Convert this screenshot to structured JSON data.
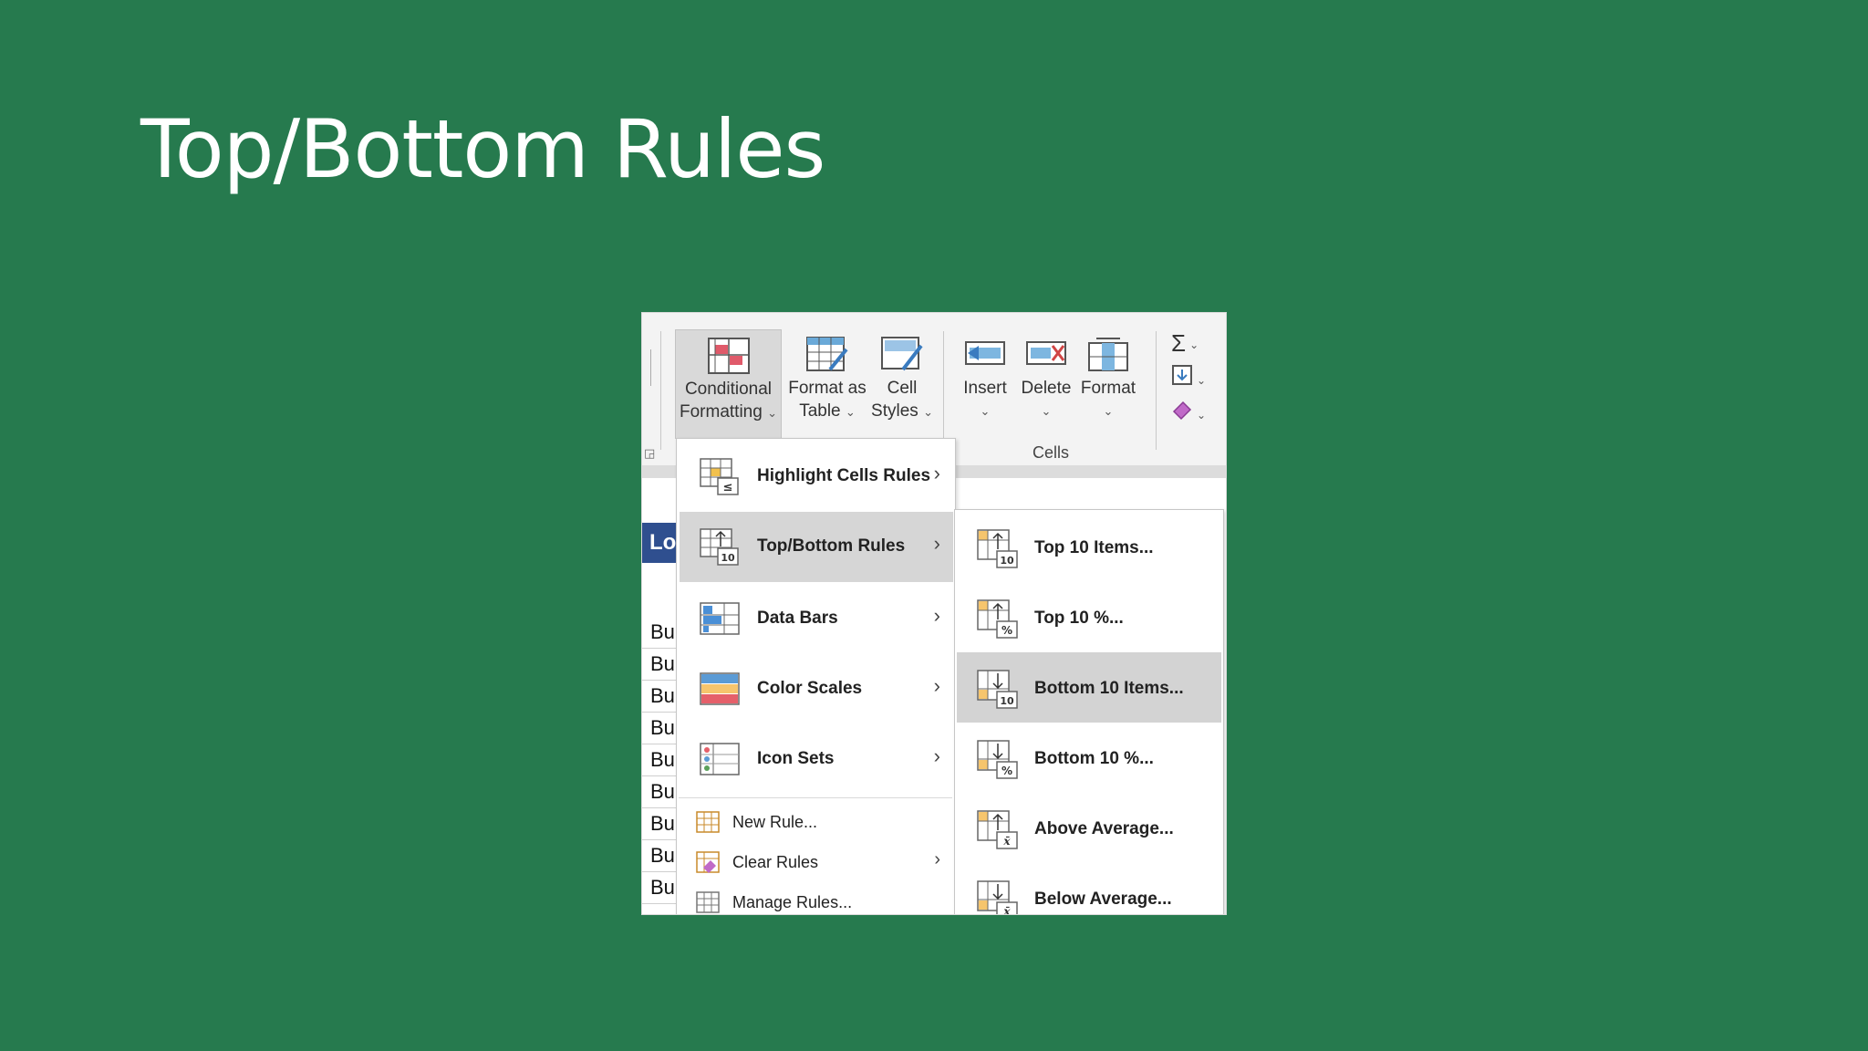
{
  "slide": {
    "title": "Top/Bottom Rules"
  },
  "ribbon": {
    "conditional_formatting": {
      "line1": "Conditional",
      "line2": "Formatting"
    },
    "format_as_table": {
      "line1": "Format as",
      "line2": "Table"
    },
    "cell_styles": {
      "line1": "Cell",
      "line2": "Styles"
    },
    "insert": "Insert",
    "delete": "Delete",
    "format": "Format",
    "cells_group": "Cells",
    "autosum_symbol": "Σ"
  },
  "sheet": {
    "column_header": "Lo",
    "cells": [
      "Bu",
      "Bu",
      "Bu",
      "Bu",
      "Bu",
      "Bu",
      "Bu",
      "Bu",
      "Bu"
    ]
  },
  "menu": {
    "items": [
      {
        "label": "Highlight Cells Rules",
        "icon": "highlight-cells-icon"
      },
      {
        "label": "Top/Bottom Rules",
        "icon": "top-bottom-icon"
      },
      {
        "label": "Data Bars",
        "icon": "data-bars-icon"
      },
      {
        "label": "Color Scales",
        "icon": "color-scales-icon"
      },
      {
        "label": "Icon Sets",
        "icon": "icon-sets-icon"
      }
    ],
    "small_items": [
      {
        "label": "New Rule...",
        "icon": "new-rule-icon"
      },
      {
        "label": "Clear Rules",
        "icon": "clear-rules-icon"
      },
      {
        "label": "Manage Rules...",
        "icon": "manage-rules-icon"
      }
    ]
  },
  "submenu": {
    "items": [
      {
        "label": "Top 10 Items...",
        "badge": "10"
      },
      {
        "label": "Top 10 %...",
        "badge": "%"
      },
      {
        "label": "Bottom 10 Items...",
        "badge": "10"
      },
      {
        "label": "Bottom 10 %...",
        "badge": "%"
      },
      {
        "label": "Above Average...",
        "badge": "x̄"
      },
      {
        "label": "Below Average...",
        "badge": "x̄"
      }
    ]
  },
  "colors": {
    "background": "#267a4e",
    "table_header": "#2f4f8f",
    "hover": "#d6d6d6"
  }
}
